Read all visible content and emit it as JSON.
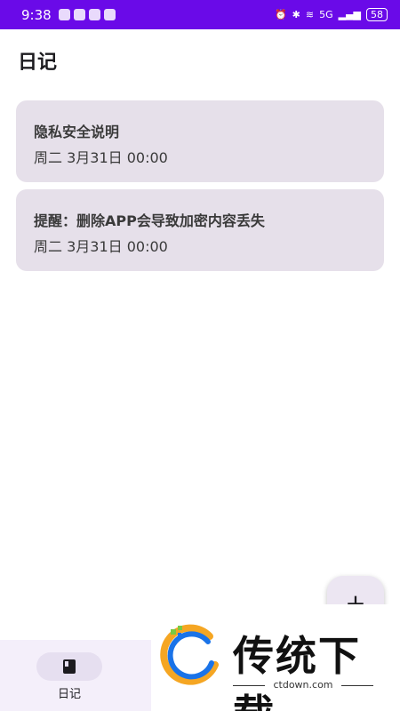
{
  "status_bar": {
    "time": "9:38",
    "network": "5G",
    "battery": "58",
    "background_color": "#6a0ae8"
  },
  "header": {
    "title": "日记"
  },
  "entries": [
    {
      "title": "隐私安全说明",
      "date": "周二 3月31日 00:00"
    },
    {
      "title": "提醒：删除APP会导致加密内容丢失",
      "date": "周二 3月31日 00:00"
    }
  ],
  "fab": {
    "label": "+",
    "icon": "plus-icon"
  },
  "bottom_nav": {
    "items": [
      {
        "label": "日记",
        "icon": "book-icon",
        "selected": true
      }
    ]
  },
  "watermark": {
    "brand": "传统下载",
    "url": "ctdown.com"
  }
}
